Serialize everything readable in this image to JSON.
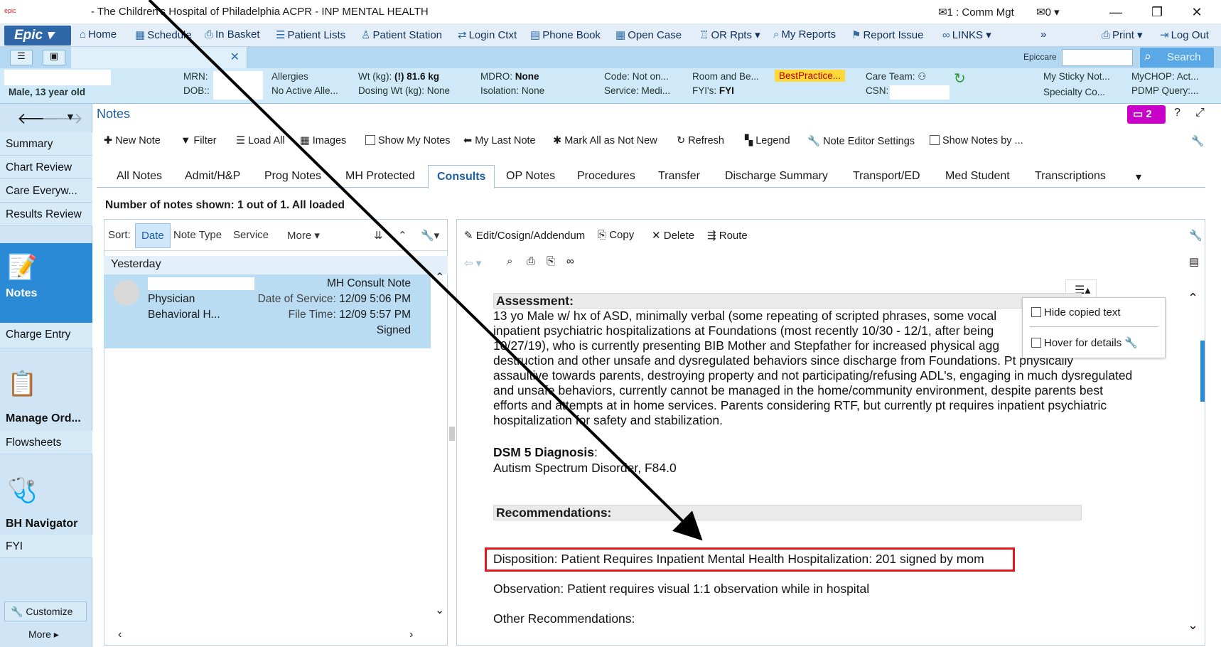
{
  "window": {
    "title": "- The Children's Hospital of Philadelphia ACPR - INP MENTAL HEALTH",
    "comm": "1 : Comm Mgt",
    "mail": "0"
  },
  "menu": {
    "epic": "Epic",
    "items": [
      "Home",
      "Schedule",
      "In Basket",
      "Patient Lists",
      "Patient Station",
      "Login Ctxt",
      "Phone Book",
      "Open Case",
      "OR Rpts",
      "My Reports",
      "Report Issue",
      "LINKS",
      "Print",
      "Log Out"
    ]
  },
  "tabrow": {
    "epiccare": "Epiccare",
    "search_placeholder": "Search"
  },
  "patient": {
    "sex_age": "Male, 13 year old",
    "mrn_label": "MRN:",
    "dob_label": "DOB::",
    "allergies_label": "Allergies",
    "allergies_val": "No Active Alle...",
    "wt_label": "Wt (kg):",
    "wt_val": "(!) 81.6 kg",
    "dosing_label": "Dosing Wt (kg):",
    "dosing_val": "None",
    "mdro_label": "MDRO:",
    "mdro_val": "None",
    "iso_label": "Isolation:",
    "iso_val": "None",
    "code": "Code: Not on...",
    "service": "Service: Medi...",
    "room": "Room and Be...",
    "fyi": "FYI's:",
    "fyi_val": "FYI",
    "bestpractice": "BestPractice...",
    "careteam": "Care Team:",
    "csn": "CSN:",
    "sticky": "My Sticky Not...",
    "specialty": "Specialty Co...",
    "mychop": "MyCHOP: Act...",
    "pdmp": "PDMP Query:..."
  },
  "leftnav": {
    "items": [
      "Summary",
      "Chart Review",
      "Care Everyw...",
      "Results Review"
    ],
    "notes": "Notes",
    "charge": "Charge Entry",
    "manage": "Manage Ord...",
    "flowsheets": "Flowsheets",
    "bh": "BH Navigator",
    "fyi": "FYI",
    "customize": "Customize",
    "more": "More"
  },
  "notes": {
    "title": "Notes",
    "badge": "2",
    "toolbar": [
      "New Note",
      "Filter",
      "Load All",
      "Images",
      "Show My Notes",
      "My Last Note",
      "Mark All as Not New",
      "Refresh",
      "Legend",
      "Note Editor Settings",
      "Show Notes by ..."
    ],
    "tabs": [
      "All Notes",
      "Admit/H&P",
      "Prog Notes",
      "MH Protected",
      "Consults",
      "OP Notes",
      "Procedures",
      "Transfer",
      "Discharge Summary",
      "Transport/ED",
      "Med Student",
      "Transcriptions"
    ],
    "shown": "Number of notes shown: 1 out of 1. All loaded",
    "sort": {
      "label": "Sort:",
      "date": "Date",
      "type": "Note Type",
      "service": "Service",
      "more": "More"
    },
    "group": "Yesterday",
    "note": {
      "type": "MH Consult Note",
      "author_role": "Physician",
      "dept": "Behavioral H...",
      "dos_label": "Date of Service:",
      "dos": "12/09 5:06 PM",
      "ft_label": "File Time:",
      "ft": "12/09 5:57 PM",
      "status": "Signed"
    }
  },
  "viewer": {
    "actions": [
      "Edit/Cosign/Addendum",
      "Copy",
      "Delete",
      "Route"
    ],
    "popup": {
      "hide": "Hide copied text",
      "hover": "Hover for details"
    },
    "doc": {
      "assessment_hdr": "Assessment:",
      "assessment_lines": [
        "13 yo Male w/ hx of ASD, minimally verbal (some repeating of scripted phrases, some vocal",
        "inpatient psychiatric hospitalizations at Foundations (most recently 10/30 - 12/1, after being",
        "10/27/19), who is currently presenting BIB Mother and Stepfather for increased physical agg",
        "destruction and other unsafe and dysregulated behaviors since discharge from Foundations.  Pt physically",
        "assaultive towards parents, destroying property and not participating/refusing ADL's, engaging in much dysregulated",
        "and unsafe behaviors, currently cannot be managed in the home/community environment, despite parents best",
        "efforts and attempts at in home services.  Parents considering RTF, but currently pt requires inpatient psychiatric",
        "hospitalization for safety and stabilization."
      ],
      "dsm_hdr": "DSM 5 Diagnosis",
      "dsm_colon": ":",
      "dsm_val": "Autism Spectrum Disorder, F84.0",
      "rec_hdr": "Recommendations:",
      "disposition": "Disposition: Patient Requires Inpatient Mental Health Hospitalization: 201 signed by mom",
      "observation": "Observation: Patient requires visual 1:1 observation while in hospital",
      "other": "Other Recommendations:"
    }
  },
  "colors": {
    "highlight_box": "#e0191e",
    "arrow": "#000000",
    "accent": "#1d5fa5"
  }
}
